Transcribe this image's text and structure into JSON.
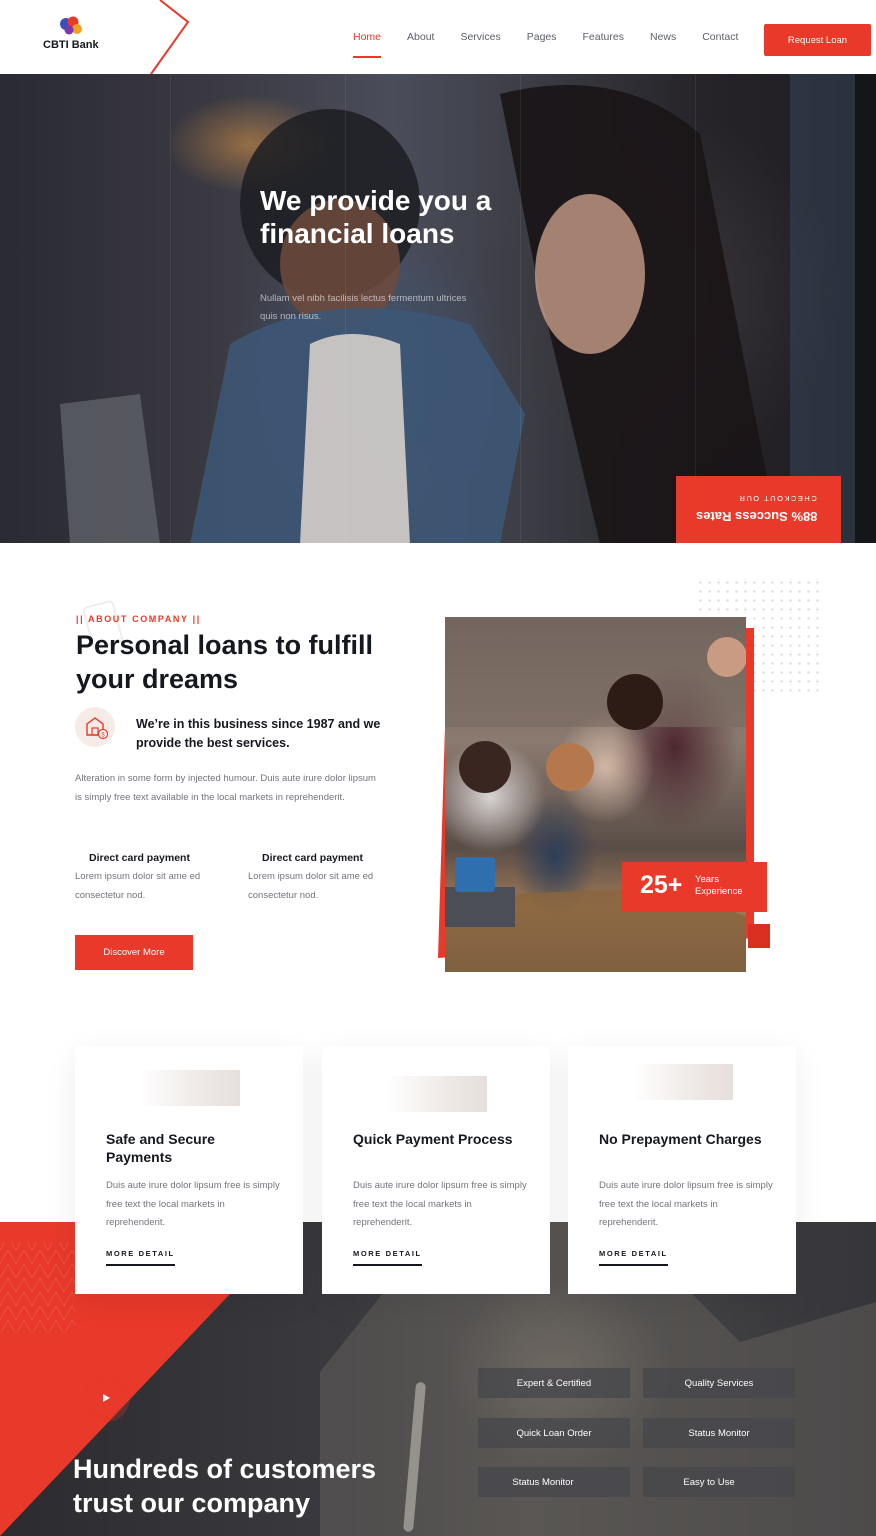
{
  "header": {
    "logo_text": "CBTI Bank",
    "nav": [
      {
        "label": "Home",
        "active": true
      },
      {
        "label": "About",
        "active": false
      },
      {
        "label": "Services",
        "active": false
      },
      {
        "label": "Pages",
        "active": false
      },
      {
        "label": "Features",
        "active": false
      },
      {
        "label": "News",
        "active": false
      },
      {
        "label": "Contact",
        "active": false
      }
    ],
    "cta_label": "Request Loan"
  },
  "hero": {
    "title": "We provide you a financial loans",
    "subtitle": "Nullam vel nibh facilisis lectus fermentum ultrices quis non risus.",
    "badge_small": "CHECKOUT OUR",
    "badge_big": "88% Success Rates"
  },
  "about": {
    "tag": "|| ABOUT COMPANY ||",
    "title": "Personal loans to fulfill your dreams",
    "lead": "We’re in this business since 1987 and we provide the best services.",
    "text": "Alteration in some form by injected humour. Duis aute irure dolor lipsum is simply free text available in the local markets in reprehenderit.",
    "features": [
      {
        "title": "Direct card payment",
        "text": "Lorem ipsum dolor sit ame ed consectetur nod."
      },
      {
        "title": "Direct card payment",
        "text": "Lorem ipsum dolor sit ame ed consectetur nod."
      }
    ],
    "button": "Discover More",
    "experience_number": "25+",
    "experience_label_1": "Years",
    "experience_label_2": "Experience"
  },
  "cards": [
    {
      "title": "Safe and Secure Payments",
      "text": "Duis aute irure dolor lipsum free is simply free text the local markets in reprehenderit.",
      "link": "MORE DETAIL"
    },
    {
      "title": "Quick Payment Process",
      "text": "Duis aute irure dolor lipsum free is simply free text the local markets in reprehenderit.",
      "link": "MORE DETAIL"
    },
    {
      "title": "No Prepayment Charges",
      "text": "Duis aute irure dolor lipsum free is simply free text the local markets in reprehenderit.",
      "link": "MORE DETAIL"
    }
  ],
  "band": {
    "title": "Hundreds of customers trust our company",
    "pills": [
      "Expert & Certified",
      "Quality Services",
      "Quick Loan Order",
      "Status Monitor",
      "Status Monitor",
      "Easy to Use"
    ]
  },
  "colors": {
    "accent": "#e8392a",
    "dark": "#16181f",
    "muted": "#73757c"
  }
}
